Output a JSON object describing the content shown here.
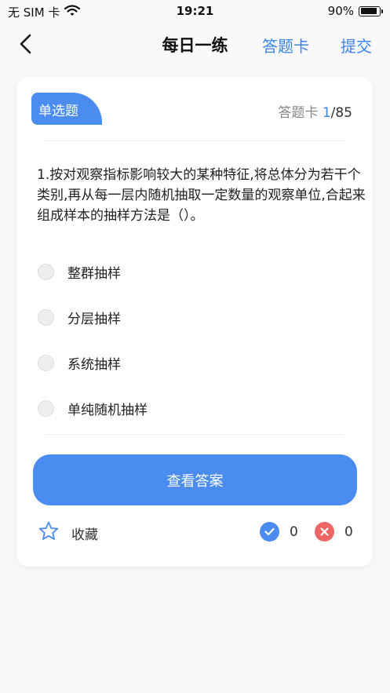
{
  "status_bar": {
    "carrier": "无 SIM 卡",
    "time": "19:21",
    "battery": "90%",
    "battery_level": 0.9,
    "wifi_icon": "wifi-icon",
    "battery_icon": "battery-icon"
  },
  "nav": {
    "back_icon": "chevron-left-icon",
    "title": "每日一练",
    "answer_card": "答题卡",
    "submit": "提交"
  },
  "question": {
    "type_label": "单选题",
    "progress_label": "答题卡",
    "current": "1",
    "total": "/85",
    "text": "1.按对观察指标影响较大的某种特征,将总体分为若干个类别,再从每一层内随机抽取一定数量的观察单位,合起来组成样本的抽样方法是（）。",
    "options": [
      {
        "label": "整群抽样"
      },
      {
        "label": "分层抽样"
      },
      {
        "label": "系统抽样"
      },
      {
        "label": "单纯随机抽样"
      }
    ]
  },
  "actions": {
    "view_answer": "查看答案",
    "favorite": "收藏",
    "favorite_icon": "star-outline-icon",
    "correct_count": "0",
    "wrong_count": "0",
    "correct_icon": "check-circle-icon",
    "wrong_icon": "x-circle-icon"
  },
  "colors": {
    "accent": "#4a8cf0",
    "link": "#3a84ee",
    "wrong": "#ee6565"
  }
}
